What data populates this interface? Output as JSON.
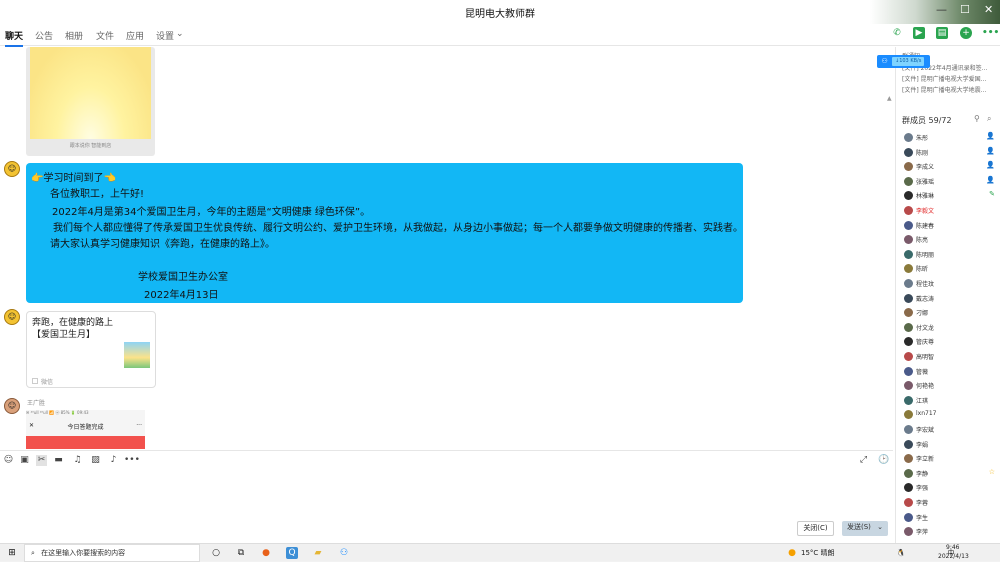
{
  "window": {
    "title": "昆明电大教师群",
    "min": "—",
    "max": "☐",
    "close": "✕"
  },
  "tabs": [
    "聊天",
    "公告",
    "相册",
    "文件",
    "应用",
    "设置"
  ],
  "tabs_chevron": "⌄",
  "header_icons": [
    "phone-icon",
    "video-icon",
    "screen-share-icon",
    "add-icon",
    "more-icon"
  ],
  "colors": {
    "accent": "#12b7f5",
    "bubble": "#12b7f5",
    "send": "#c8d6e1"
  },
  "image_caption": "跟本说你 智能到店",
  "message": {
    "title": "👉学习时间到了👈",
    "greet": "各位教职工，上午好!",
    "line1": "2022年4月是第34个爱国卫生月，今年的主题是“文明健康 绿色环保”。",
    "line2": "我们每个人都应懂得了传承爱国卫生优良传统、履行文明公约、爱护卫生环境，从我做起，从身边小事做起；每一个人都要争做文明健康的传播者、实践者。",
    "line3": "请大家认真学习健康知识《奔跑，在健康的路上》。",
    "sign": "学校爱国卫生办公室",
    "date": "2022年4月13日"
  },
  "link_card": {
    "title": "奔跑，在健康的路上【爱国卫生月】",
    "source": "微信"
  },
  "sender2": "王广胜",
  "phone_shot": {
    "status": "✉ ⁴⁶ull ⁴⁶ull 📶      ⓦ 85% 🔋 09:43",
    "title": "今日答题完成",
    "close": "✕",
    "more": "···"
  },
  "toolbar_icons": [
    "emoji-icon",
    "screenshot-icon",
    "scissors-icon",
    "folder-icon",
    "music-icon",
    "image-icon",
    "bell-icon",
    "more-icon"
  ],
  "expand_icon": "⤢",
  "history_icon": "🕑",
  "buttons": {
    "close": "关闭(C)",
    "send": "发送(S)",
    "send_arrow": "⌄"
  },
  "speed": {
    "text": "↓103 KB/s"
  },
  "sidebar": {
    "notice_label": "群通知",
    "files": [
      "[文件] 2022年4月通讯录和签...",
      "[文件] 昆明广播电视大学爱国...",
      "[文件] 昆明广播电视大学地震..."
    ],
    "members_title": "群成员 59/72",
    "members": [
      {
        "name": "朱彤",
        "role": "👤"
      },
      {
        "name": "陈刚",
        "role": "👤"
      },
      {
        "name": "李成义",
        "role": "👤"
      },
      {
        "name": "张雅瑶",
        "role": "👤"
      },
      {
        "name": "林雅琳",
        "role": "✎"
      },
      {
        "name": "李毅文",
        "role": ""
      },
      {
        "name": "陈建春",
        "role": ""
      },
      {
        "name": "陈亮",
        "role": ""
      },
      {
        "name": "陈明丽",
        "role": ""
      },
      {
        "name": "陈昕",
        "role": ""
      },
      {
        "name": "程佳玟",
        "role": ""
      },
      {
        "name": "戴志涛",
        "role": ""
      },
      {
        "name": "刁娜",
        "role": ""
      },
      {
        "name": "付文龙",
        "role": ""
      },
      {
        "name": "管庆尊",
        "role": ""
      },
      {
        "name": "高明智",
        "role": ""
      },
      {
        "name": "管薇",
        "role": ""
      },
      {
        "name": "何艳艳",
        "role": ""
      },
      {
        "name": "江琪",
        "role": ""
      },
      {
        "name": "lxn717",
        "role": ""
      },
      {
        "name": "李宏斌",
        "role": ""
      },
      {
        "name": "李娟",
        "role": ""
      },
      {
        "name": "李立新",
        "role": ""
      },
      {
        "name": "李静",
        "role": "☆"
      },
      {
        "name": "李强",
        "role": ""
      },
      {
        "name": "李蓉",
        "role": ""
      },
      {
        "name": "李生",
        "role": ""
      },
      {
        "name": "李萍",
        "role": ""
      }
    ]
  },
  "taskbar": {
    "start": "⊞",
    "search_placeholder": "在这里输入你要搜索的内容",
    "weather": "15°C 晴朗",
    "time": "9:46",
    "date": "2022/4/13",
    "ime": "中"
  }
}
